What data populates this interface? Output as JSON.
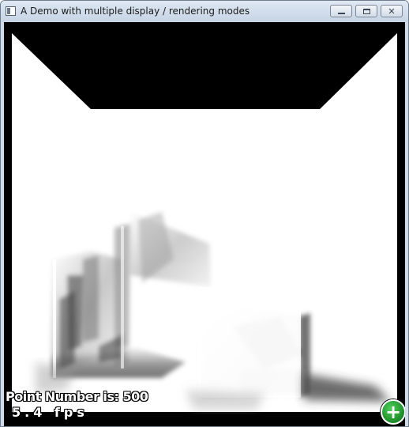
{
  "window": {
    "title": "A Demo with multiple display / rendering modes",
    "controls": {
      "minimize": "minimize",
      "maximize": "maximize",
      "close": "✕"
    }
  },
  "hud": {
    "point_number": "Point Number is: 500",
    "fps": "5.4 fps"
  },
  "overlay": {
    "add_icon": "+"
  },
  "colors": {
    "scene_bg": "#000000",
    "accent_green": "#1c8a28"
  }
}
